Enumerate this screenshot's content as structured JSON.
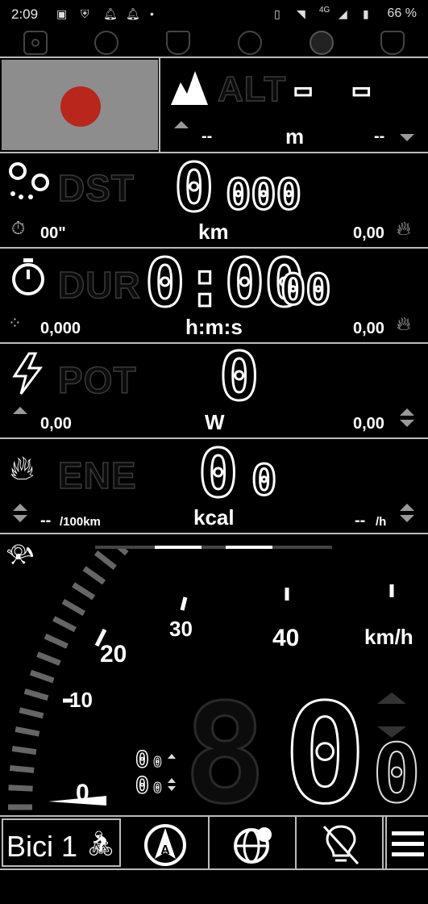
{
  "status_bar": {
    "time": "2:09",
    "network": "4G",
    "battery": "66 %"
  },
  "tabs": [
    "record-tab",
    "sensor-tab",
    "shield-tab",
    "activity-tab",
    "map-pin-tab",
    "pocket-tab"
  ],
  "altitude": {
    "label": "ALT",
    "value": "- -",
    "unit": "m",
    "left_value": "--",
    "right_value": "--"
  },
  "distance": {
    "label": "DST",
    "value_main": "0",
    "value_small": "000",
    "unit": "km",
    "left_value": "00\"",
    "right_value": "0,00"
  },
  "duration": {
    "label": "DUR",
    "value_main": "0:00",
    "value_small": "00",
    "unit": "h:m:s",
    "left_value": "0,000",
    "right_value": "0,00"
  },
  "power": {
    "label": "POT",
    "value_main": "0",
    "unit": "W",
    "left_value": "0,00",
    "right_value": "0,00"
  },
  "energy": {
    "label": "ENE",
    "value_main": "0",
    "value_small": "0",
    "unit": "kcal",
    "left_value": "--",
    "left_unit": "/100km",
    "right_value": "--",
    "right_unit": "/h"
  },
  "speedometer": {
    "scale_labels": [
      "0",
      "10",
      "20",
      "30",
      "40"
    ],
    "unit": "km/h",
    "speed_main": "0",
    "speed_small": "0",
    "aux_top": "0",
    "aux_top_small": "0",
    "aux_bottom": "0",
    "aux_bottom_small": "0"
  },
  "bottom_bar": {
    "profile_label": "Bici 1",
    "compass_letter": "A"
  },
  "colors": {
    "record_dot": "#b8261c",
    "camera_bg": "#8d8d8d"
  }
}
